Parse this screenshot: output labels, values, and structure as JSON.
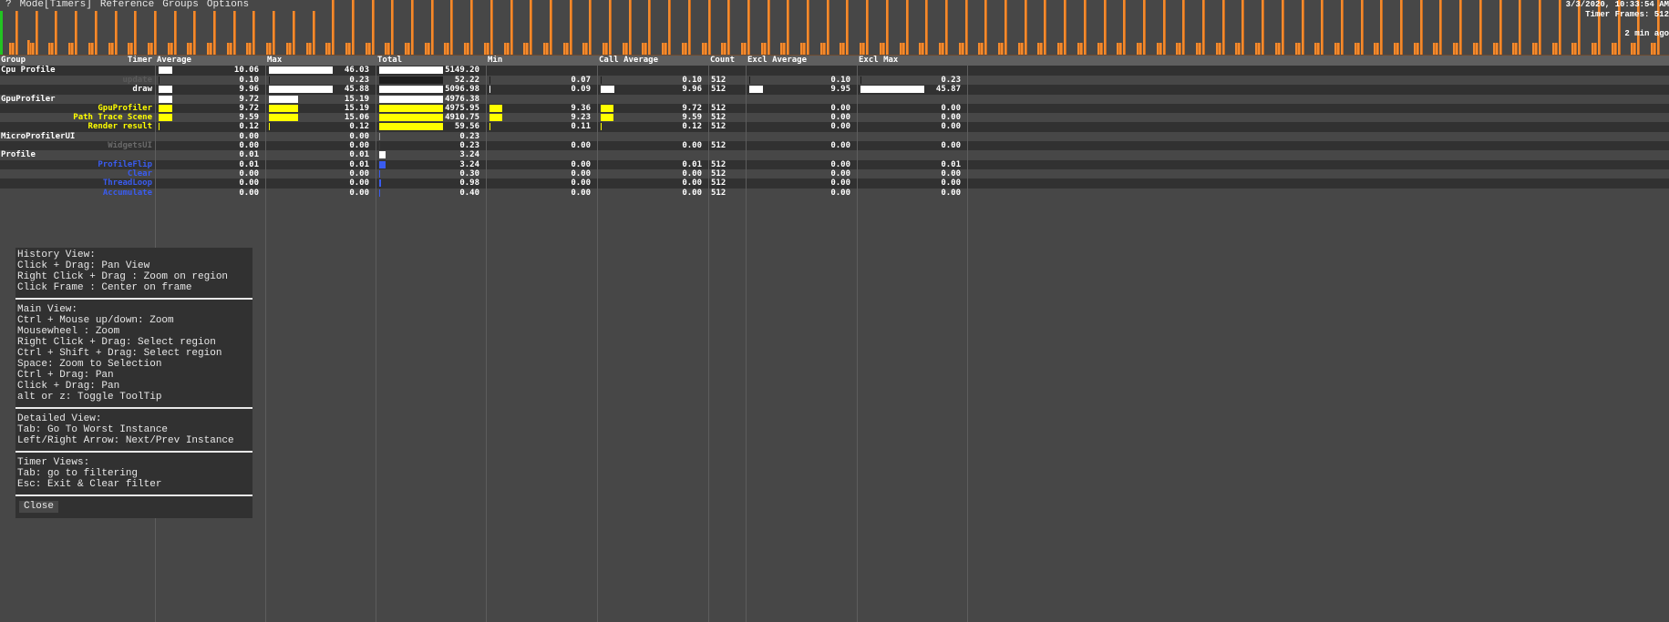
{
  "menu": {
    "items": [
      "?",
      "Mode[Timers]",
      "Reference",
      "Groups",
      "Options"
    ]
  },
  "status": {
    "datetime": "3/3/2020, 10:33:54 AM",
    "timer_frames": "Timer Frames: 512",
    "ago": "2 min ago"
  },
  "history": {
    "bar_color": "#f28a2e",
    "cursor_color": "#22c422",
    "groups": 84,
    "short_frame_ms": 9.7,
    "tall_frame_ms_early": 41.0,
    "tall_frame_ms_late": 46.0,
    "scale_max_ms": 46.03
  },
  "columns": [
    "Group",
    "Timer",
    "Average",
    "Max",
    "Total",
    "Min",
    "Call Average",
    "Count",
    "Excl Average",
    "Excl Max"
  ],
  "rows": [
    {
      "type": "group",
      "name": "Cpu Profile",
      "color": "#ffffff",
      "avg": "10.06",
      "max": "46.03",
      "total": "5149.20",
      "min": "",
      "callavg": "",
      "count": "",
      "exclavg": "",
      "exclmax": "",
      "bars": {
        "avg": 0.22,
        "max": 1,
        "total": 1,
        "min": 0,
        "callavg": 0,
        "exclavg": 0,
        "exclmax": 0
      },
      "barcolor": "#ffffff"
    },
    {
      "type": "timer",
      "name": "update",
      "color": "#5a5a5a",
      "avg": "0.10",
      "max": "0.23",
      "total": "52.22",
      "min": "0.07",
      "callavg": "0.10",
      "count": "512",
      "exclavg": "0.10",
      "exclmax": "0.23",
      "bars": {
        "avg": 0.01,
        "max": 0.01,
        "total": 1,
        "min": 0.01,
        "callavg": 0.01,
        "exclavg": 0.01,
        "exclmax": 0.01
      },
      "barcolor": "#1e1e1e"
    },
    {
      "type": "timer",
      "name": "draw",
      "color": "#ffffff",
      "avg": "9.96",
      "max": "45.88",
      "total": "5096.98",
      "min": "0.09",
      "callavg": "9.96",
      "count": "512",
      "exclavg": "9.95",
      "exclmax": "45.87",
      "bars": {
        "avg": 0.22,
        "max": 1,
        "total": 1,
        "min": 0.01,
        "callavg": 0.22,
        "exclavg": 0.22,
        "exclmax": 1
      },
      "barcolor": "#ffffff"
    },
    {
      "type": "group",
      "name": "GpuProfiler",
      "color": "#ffffff",
      "avg": "9.72",
      "max": "15.19",
      "total": "4976.38",
      "min": "",
      "callavg": "",
      "count": "",
      "exclavg": "",
      "exclmax": "",
      "bars": {
        "avg": 0.22,
        "max": 0.46,
        "total": 1,
        "min": 0,
        "callavg": 0,
        "exclavg": 0,
        "exclmax": 0
      },
      "barcolor": "#ffffff"
    },
    {
      "type": "timer",
      "name": "GpuProfiler",
      "color": "#ffff00",
      "avg": "9.72",
      "max": "15.19",
      "total": "4975.95",
      "min": "9.36",
      "callavg": "9.72",
      "count": "512",
      "exclavg": "0.00",
      "exclmax": "0.00",
      "bars": {
        "avg": 0.22,
        "max": 0.46,
        "total": 1,
        "min": 0.2,
        "callavg": 0.2,
        "exclavg": 0,
        "exclmax": 0
      },
      "barcolor": "#ffff00"
    },
    {
      "type": "timer",
      "name": "Path Trace Scene",
      "color": "#ffff00",
      "avg": "9.59",
      "max": "15.06",
      "total": "4910.75",
      "min": "9.23",
      "callavg": "9.59",
      "count": "512",
      "exclavg": "0.00",
      "exclmax": "0.00",
      "bars": {
        "avg": 0.22,
        "max": 0.46,
        "total": 1,
        "min": 0.2,
        "callavg": 0.2,
        "exclavg": 0,
        "exclmax": 0
      },
      "barcolor": "#ffff00"
    },
    {
      "type": "timer",
      "name": "Render result",
      "color": "#ffff00",
      "avg": "0.12",
      "max": "0.12",
      "total": "59.56",
      "min": "0.11",
      "callavg": "0.12",
      "count": "512",
      "exclavg": "0.00",
      "exclmax": "0.00",
      "bars": {
        "avg": 0.01,
        "max": 0.01,
        "total": 1,
        "min": 0.01,
        "callavg": 0.01,
        "exclavg": 0,
        "exclmax": 0
      },
      "barcolor": "#ffff00"
    },
    {
      "type": "group",
      "name": "MicroProfilerUI",
      "color": "#ffffff",
      "avg": "0.00",
      "max": "0.00",
      "total": "0.23",
      "min": "",
      "callavg": "",
      "count": "",
      "exclavg": "",
      "exclmax": "",
      "bars": {
        "avg": 0,
        "max": 0,
        "total": 0.01,
        "min": 0,
        "callavg": 0,
        "exclavg": 0,
        "exclmax": 0
      },
      "barcolor": "#9a9a9a"
    },
    {
      "type": "timer",
      "name": "WidgetsUI",
      "color": "#6a6a6a",
      "avg": "0.00",
      "max": "0.00",
      "total": "0.23",
      "min": "0.00",
      "callavg": "0.00",
      "count": "512",
      "exclavg": "0.00",
      "exclmax": "0.00",
      "bars": {
        "avg": 0,
        "max": 0,
        "total": 0.01,
        "min": 0,
        "callavg": 0,
        "exclavg": 0,
        "exclmax": 0
      },
      "barcolor": "#3a3a3a"
    },
    {
      "type": "group",
      "name": "Profile",
      "color": "#ffffff",
      "avg": "0.01",
      "max": "0.01",
      "total": "3.24",
      "min": "",
      "callavg": "",
      "count": "",
      "exclavg": "",
      "exclmax": "",
      "bars": {
        "avg": 0,
        "max": 0,
        "total": 0.1,
        "min": 0,
        "callavg": 0,
        "exclavg": 0,
        "exclmax": 0
      },
      "barcolor": "#ffffff"
    },
    {
      "type": "timer",
      "name": "ProfileFlip",
      "color": "#3a5cf0",
      "avg": "0.01",
      "max": "0.01",
      "total": "3.24",
      "min": "0.00",
      "callavg": "0.01",
      "count": "512",
      "exclavg": "0.00",
      "exclmax": "0.01",
      "bars": {
        "avg": 0,
        "max": 0,
        "total": 0.1,
        "min": 0,
        "callavg": 0,
        "exclavg": 0,
        "exclmax": 0
      },
      "barcolor": "#3a5cf0"
    },
    {
      "type": "timer",
      "name": "Clear",
      "color": "#3a5cf0",
      "avg": "0.00",
      "max": "0.00",
      "total": "0.30",
      "min": "0.00",
      "callavg": "0.00",
      "count": "512",
      "exclavg": "0.00",
      "exclmax": "0.00",
      "bars": {
        "avg": 0,
        "max": 0,
        "total": 0.01,
        "min": 0,
        "callavg": 0,
        "exclavg": 0,
        "exclmax": 0
      },
      "barcolor": "#3a5cf0"
    },
    {
      "type": "timer",
      "name": "ThreadLoop",
      "color": "#3a5cf0",
      "avg": "0.00",
      "max": "0.00",
      "total": "0.98",
      "min": "0.00",
      "callavg": "0.00",
      "count": "512",
      "exclavg": "0.00",
      "exclmax": "0.00",
      "bars": {
        "avg": 0,
        "max": 0,
        "total": 0.03,
        "min": 0,
        "callavg": 0,
        "exclavg": 0,
        "exclmax": 0
      },
      "barcolor": "#3a5cf0"
    },
    {
      "type": "timer",
      "name": "Accumulate",
      "color": "#3a5cf0",
      "avg": "0.00",
      "max": "0.00",
      "total": "0.40",
      "min": "0.00",
      "callavg": "0.00",
      "count": "512",
      "exclavg": "0.00",
      "exclmax": "0.00",
      "bars": {
        "avg": 0,
        "max": 0,
        "total": 0.01,
        "min": 0,
        "callavg": 0,
        "exclavg": 0,
        "exclmax": 0
      },
      "barcolor": "#3a5cf0"
    }
  ],
  "help": {
    "sections": [
      [
        "History View:",
        "Click + Drag: Pan View",
        "Right Click + Drag : Zoom on region",
        "Click Frame : Center on frame"
      ],
      [
        "Main View:",
        "Ctrl + Mouse up/down: Zoom",
        "Mousewheel : Zoom",
        "Right Click + Drag: Select region",
        "Ctrl + Shift + Drag: Select region",
        "Space: Zoom to Selection",
        "Ctrl + Drag: Pan",
        "Click + Drag: Pan",
        "alt or z: Toggle ToolTip"
      ],
      [
        "Detailed View:",
        "Tab: Go To Worst Instance",
        "Left/Right Arrow: Next/Prev Instance"
      ],
      [
        "Timer Views:",
        "Tab: go to filtering",
        "Esc: Exit & Clear filter"
      ]
    ],
    "close_label": "Close"
  }
}
